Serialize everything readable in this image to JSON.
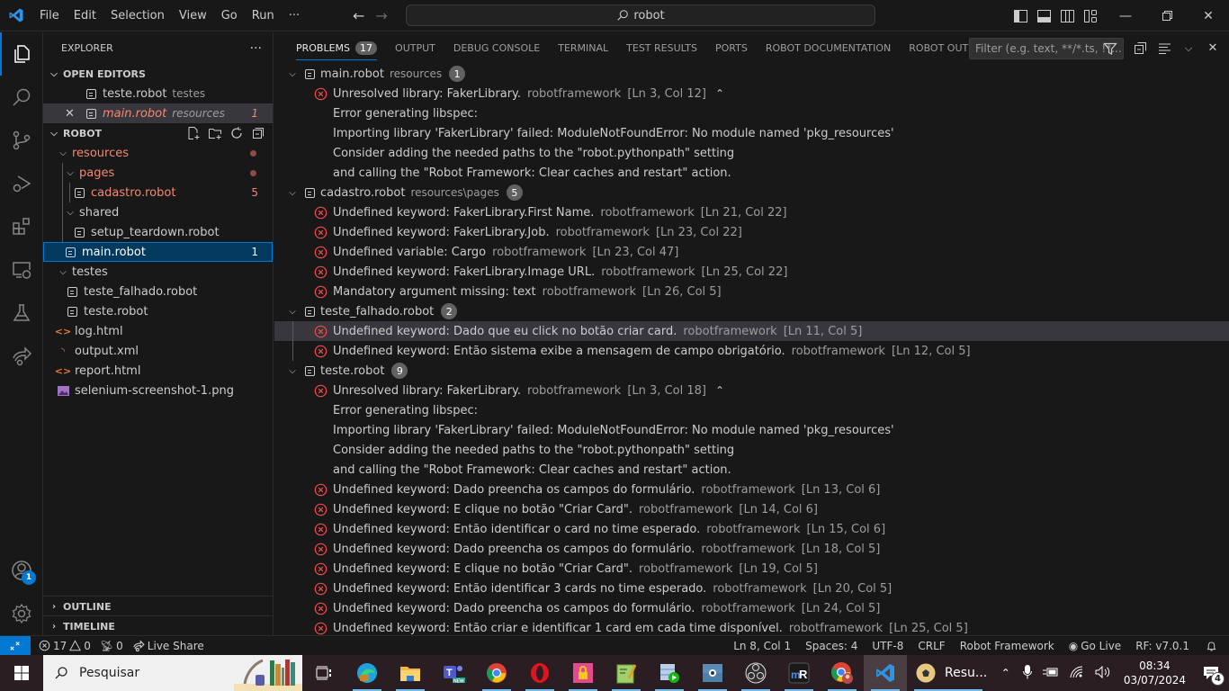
{
  "titlebar": {
    "menu": [
      "File",
      "Edit",
      "Selection",
      "View",
      "Go",
      "Run",
      "···"
    ],
    "search_text": "robot",
    "icons": [
      "vscode-logo",
      "back-arrow",
      "forward-arrow",
      "toggle-primary-sidebar",
      "toggle-panel",
      "toggle-secondary-sidebar",
      "customize-layout",
      "minimize",
      "restore",
      "close"
    ]
  },
  "activitybar": {
    "items": [
      "explorer",
      "search",
      "source-control",
      "run-and-debug",
      "extensions",
      "remote-explorer",
      "testing",
      "live-share"
    ],
    "accounts_badge": "1"
  },
  "sidebar": {
    "title": "EXPLORER",
    "more": "···",
    "open_editors_label": "OPEN EDITORS",
    "open_editors": [
      {
        "name": "teste.robot",
        "desc": "testes",
        "count": ""
      },
      {
        "name": "main.robot",
        "desc": "resources",
        "count": "1"
      }
    ],
    "folder_label": "ROBOT",
    "tree": [
      {
        "name": "resources",
        "type": "folder"
      },
      {
        "name": "pages",
        "type": "folder"
      },
      {
        "name": "cadastro.robot",
        "type": "robot",
        "count": "5"
      },
      {
        "name": "shared",
        "type": "folder"
      },
      {
        "name": "setup_teardown.robot",
        "type": "robot"
      },
      {
        "name": "main.robot",
        "type": "robot",
        "count": "1"
      },
      {
        "name": "testes",
        "type": "folder"
      },
      {
        "name": "teste_falhado.robot",
        "type": "robot"
      },
      {
        "name": "teste.robot",
        "type": "robot"
      },
      {
        "name": "log.html",
        "type": "html"
      },
      {
        "name": "output.xml",
        "type": "xml"
      },
      {
        "name": "report.html",
        "type": "html"
      },
      {
        "name": "selenium-screenshot-1.png",
        "type": "image"
      }
    ],
    "outline_label": "OUTLINE",
    "timeline_label": "TIMELINE"
  },
  "panel": {
    "tabs": [
      {
        "label": "PROBLEMS",
        "badge": "17"
      },
      {
        "label": "OUTPUT"
      },
      {
        "label": "DEBUG CONSOLE"
      },
      {
        "label": "TERMINAL"
      },
      {
        "label": "TEST RESULTS"
      },
      {
        "label": "PORTS"
      },
      {
        "label": "ROBOT DOCUMENTATION"
      },
      {
        "label": "ROBOT OUTPUT"
      }
    ],
    "filter_placeholder": "Filter (e.g. text, **/*.ts, !*..."
  },
  "problems": {
    "source": "robotframework",
    "files": [
      {
        "name": "main.robot",
        "desc": "resources",
        "count": "1",
        "items": [
          {
            "msg": "Unresolved library: FakerLibrary.",
            "loc": "[Ln 3, Col 12]",
            "expanded": true,
            "details": [
              "Error generating libspec:",
              "Importing library 'FakerLibrary' failed: ModuleNotFoundError: No module named 'pkg_resources'",
              "Consider adding the needed paths to the \"robot.pythonpath\" setting",
              "and calling the \"Robot Framework: Clear caches and restart\" action."
            ]
          }
        ]
      },
      {
        "name": "cadastro.robot",
        "desc": "resources\\pages",
        "count": "5",
        "items": [
          {
            "msg": "Undefined keyword: FakerLibrary.First Name.",
            "loc": "[Ln 21, Col 22]"
          },
          {
            "msg": "Undefined keyword: FakerLibrary.Job.",
            "loc": "[Ln 23, Col 22]"
          },
          {
            "msg": "Undefined variable: Cargo",
            "loc": "[Ln 23, Col 47]"
          },
          {
            "msg": "Undefined keyword: FakerLibrary.Image URL.",
            "loc": "[Ln 25, Col 22]"
          },
          {
            "msg": "Mandatory argument missing: text",
            "loc": "[Ln 26, Col 5]"
          }
        ]
      },
      {
        "name": "teste_falhado.robot",
        "desc": "",
        "count": "2",
        "items": [
          {
            "msg": "Undefined keyword: Dado que eu click no botão criar card.",
            "loc": "[Ln 11, Col 5]"
          },
          {
            "msg": "Undefined keyword: Então sistema exibe a mensagem de campo obrigatório.",
            "loc": "[Ln 12, Col 5]"
          }
        ]
      },
      {
        "name": "teste.robot",
        "desc": "",
        "count": "9",
        "items": [
          {
            "msg": "Unresolved library: FakerLibrary.",
            "loc": "[Ln 3, Col 18]",
            "expanded": true,
            "details": [
              "Error generating libspec:",
              "Importing library 'FakerLibrary' failed: ModuleNotFoundError: No module named 'pkg_resources'",
              "Consider adding the needed paths to the \"robot.pythonpath\" setting",
              "and calling the \"Robot Framework: Clear caches and restart\" action."
            ]
          },
          {
            "msg": "Undefined keyword: Dado preencha os campos do formulário.",
            "loc": "[Ln 13, Col 6]"
          },
          {
            "msg": "Undefined keyword: E clique no botão \"Criar Card\".",
            "loc": "[Ln 14, Col 6]"
          },
          {
            "msg": "Undefined keyword: Então identificar o card no time esperado.",
            "loc": "[Ln 15, Col 6]"
          },
          {
            "msg": "Undefined keyword: Dado preencha os campos do formulário.",
            "loc": "[Ln 18, Col 5]"
          },
          {
            "msg": "Undefined keyword: E clique no botão \"Criar Card\".",
            "loc": "[Ln 19, Col 5]"
          },
          {
            "msg": "Undefined keyword: Então identificar 3 cards no time esperado.",
            "loc": "[Ln 20, Col 5]"
          },
          {
            "msg": "Undefined keyword: Dado preencha os campos do formulário.",
            "loc": "[Ln 24, Col 5]"
          },
          {
            "msg": "Undefined keyword: Então criar e identificar 1 card em cada time disponível.",
            "loc": "[Ln 25, Col 5]"
          }
        ]
      }
    ]
  },
  "statusbar": {
    "errors": "17",
    "warnings": "0",
    "ports": "0",
    "live_share": "Live Share",
    "position": "Ln 8, Col 1",
    "spaces": "Spaces: 4",
    "encoding": "UTF-8",
    "eol": "CRLF",
    "language": "Robot Framework",
    "go_live": "Go Live",
    "rf_version": "RF: v7.0.1"
  },
  "taskbar": {
    "search_placeholder": "Pesquisar",
    "apps": [
      "task-view",
      "edge",
      "file-explorer",
      "teams",
      "chrome",
      "opera",
      "lock-app",
      "notepad-plus-plus",
      "media-app",
      "screen-app",
      "obs",
      "mremoteng",
      "chrome-profile",
      "vscode"
    ],
    "running_app_label": "Resu...",
    "time": "08:34",
    "date": "03/07/2024",
    "notifications": "4",
    "colors": {
      "accent": "#0078d4",
      "error": "#f14c4c"
    }
  }
}
